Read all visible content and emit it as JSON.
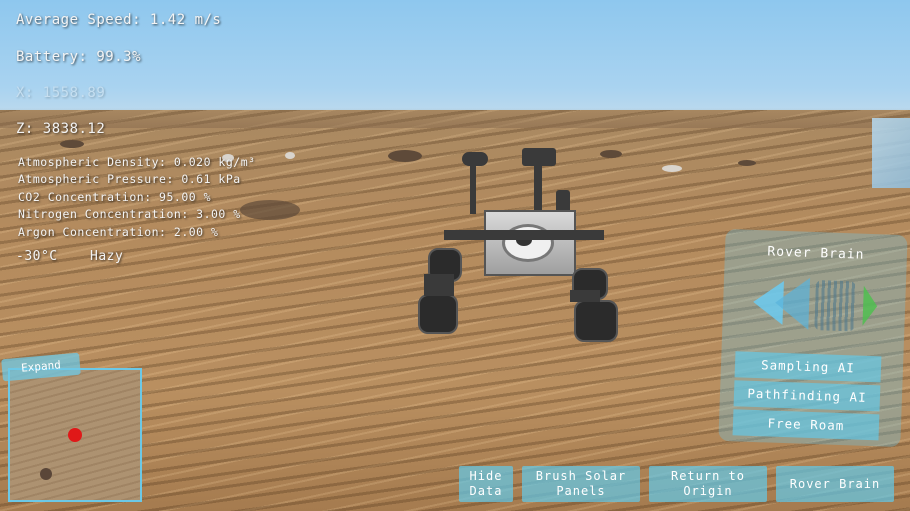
{
  "hud": {
    "average_speed": "Average Speed: 1.42 m/s",
    "battery": "Battery: 99.3%",
    "x": "X: 1558.89",
    "z": "Z: 3838.12",
    "atmospheric_density": "Atmospheric Density: 0.020 kg/m³",
    "atmospheric_pressure": "Atmospheric Pressure: 0.61 kPa",
    "co2": "CO2 Concentration: 95.00 %",
    "nitrogen": "Nitrogen Concentration: 3.00 %",
    "argon": "Argon Concentration: 2.00 %",
    "temperature": "-30°C",
    "weather": "Hazy"
  },
  "minimap": {
    "expand_label": "Expand"
  },
  "rover_brain": {
    "title": "Rover Brain",
    "prev_icon": "left-arrow-icon",
    "next_icon": "right-arrow-icon",
    "options": [
      "Sampling AI",
      "Pathfinding AI",
      "Free Roam"
    ]
  },
  "buttons": {
    "hide_data": "Hide Data",
    "brush_solar": "Brush Solar Panels",
    "return_origin": "Return to Origin",
    "rover_brain": "Rover Brain"
  },
  "colors": {
    "ui_accent": "#64c8e6",
    "marker": "#e01818"
  }
}
